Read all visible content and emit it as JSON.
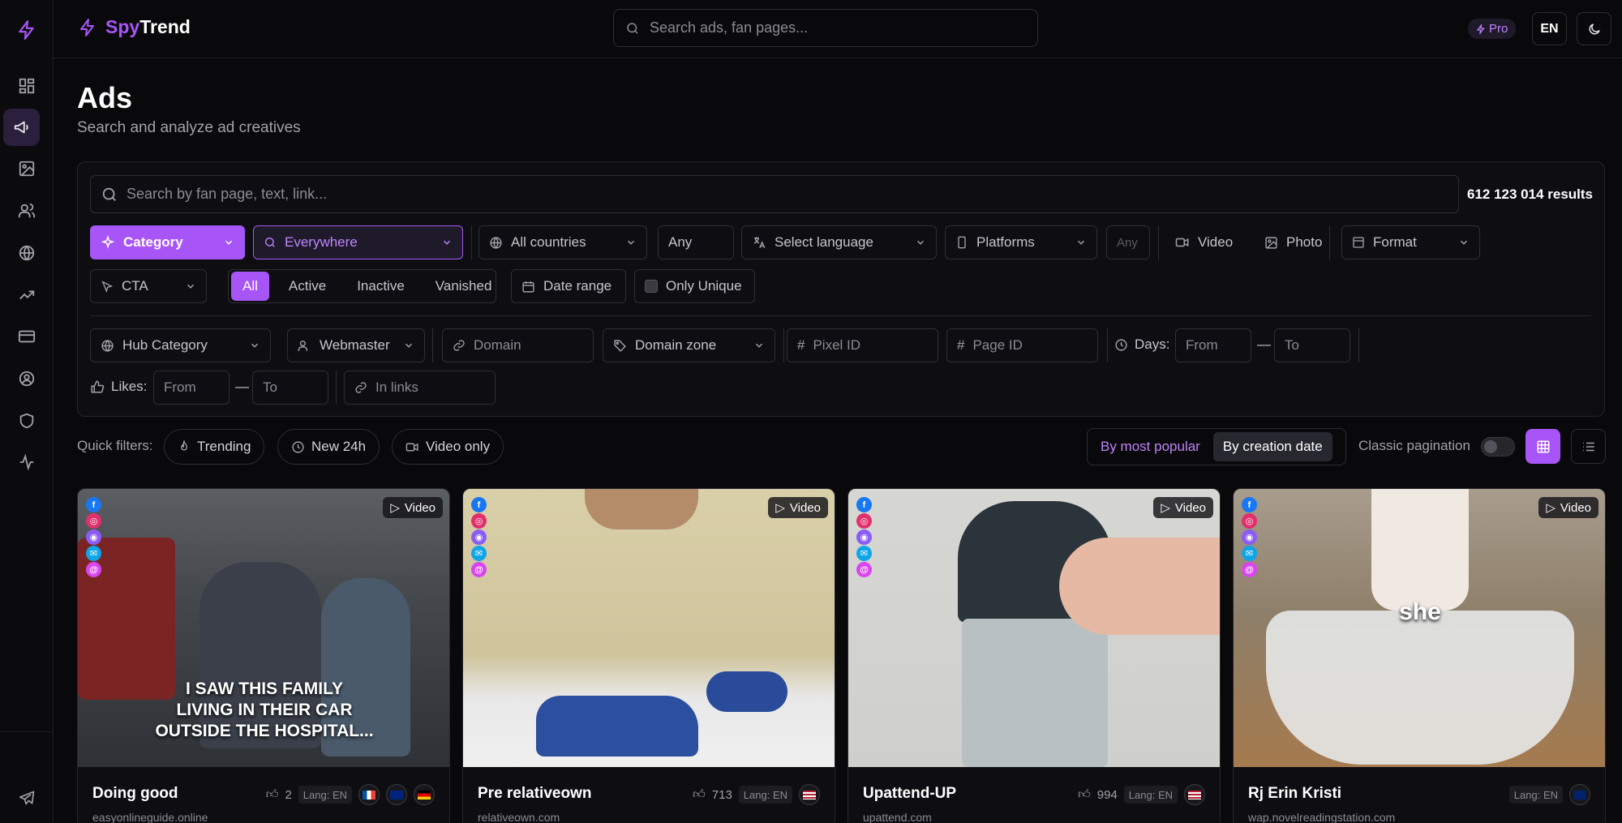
{
  "brand": {
    "part1": "Spy",
    "part2": "Trend"
  },
  "top_search": {
    "placeholder": "Search ads, fan pages..."
  },
  "pro_label": "Pro",
  "lang_label": "EN",
  "page": {
    "title": "Ads",
    "subtitle": "Search and analyze ad creatives"
  },
  "filters": {
    "search_placeholder": "Search by fan page, text, link...",
    "results": "612 123 014 results",
    "category": "Category",
    "everywhere": "Everywhere",
    "countries": "All countries",
    "any1": "Any",
    "language": "Select language",
    "platforms": "Platforms",
    "any2": "Any",
    "video": "Video",
    "photo": "Photo",
    "format": "Format",
    "cta": "CTA",
    "status": [
      "All",
      "Active",
      "Inactive",
      "Vanished"
    ],
    "date_range": "Date range",
    "only_unique": "Only Unique",
    "hub_category": "Hub Category",
    "webmaster": "Webmaster",
    "domain": "Domain",
    "domain_zone": "Domain zone",
    "pixel_id": "Pixel ID",
    "page_id": "Page ID",
    "days_label": "Days:",
    "from": "From",
    "to": "To",
    "dash": "—",
    "likes_label": "Likes:",
    "in_links": "In links"
  },
  "quick_filters": {
    "label": "Quick filters:",
    "items": [
      "Trending",
      "New 24h",
      "Video only"
    ]
  },
  "sort": {
    "popular": "By most popular",
    "creation": "By creation date"
  },
  "classic_pagination": "Classic pagination",
  "cards": [
    {
      "title": "Doing good",
      "domain": "easyonlineguide.online",
      "likes": "2",
      "lang": "Lang: EN",
      "badge": "Video",
      "caption": [
        "I SAW THIS FAMILY",
        "LIVING IN THEIR CAR",
        "OUTSIDE THE HOSPITAL..."
      ]
    },
    {
      "title": "Pre relativeown",
      "domain": "relativeown.com",
      "likes": "713",
      "lang": "Lang: EN",
      "badge": "Video",
      "caption": []
    },
    {
      "title": "Upattend-UP",
      "domain": "upattend.com",
      "likes": "994",
      "lang": "Lang: EN",
      "badge": "Video",
      "caption": []
    },
    {
      "title": "Rj Erin Kristi",
      "domain": "wap.novelreadingstation.com",
      "likes": "",
      "lang": "Lang: EN",
      "badge": "Video",
      "caption": [
        "she"
      ]
    }
  ],
  "colors": {
    "accent": "#a855f7",
    "bg": "#09090b"
  }
}
